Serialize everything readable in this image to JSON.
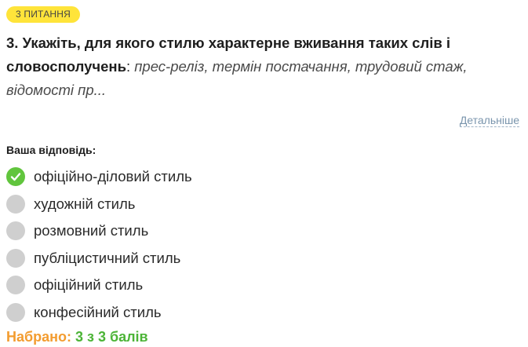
{
  "question_badge": "3 ПИТАННЯ",
  "question": {
    "bold_text": "3. Укажіть, для якого стилю характерне вживання таких слів і словосполучень",
    "separator": ":",
    "italic_text": "прес-реліз, термін постачання, трудовий стаж, відомості пр..."
  },
  "details_link": "Детальніше",
  "answer_label": "Ваша відповідь:",
  "options": [
    {
      "label": "офіційно-діловий стиль",
      "state": "correct-selected",
      "icon": "check-icon"
    },
    {
      "label": "художній стиль",
      "state": "unselected",
      "icon": "radio-icon"
    },
    {
      "label": "розмовний стиль",
      "state": "unselected",
      "icon": "radio-icon"
    },
    {
      "label": "публіцистичний стиль",
      "state": "unselected",
      "icon": "radio-icon"
    },
    {
      "label": "офіційний стиль",
      "state": "unselected",
      "icon": "radio-icon"
    },
    {
      "label": "конфесійний стиль",
      "state": "unselected",
      "icon": "radio-icon"
    }
  ],
  "score": {
    "label": "Набрано:",
    "value": "3 з 3 балів"
  },
  "colors": {
    "badge": "#ffe43a",
    "correct": "#61c53d",
    "unselected": "#cfcfcf",
    "score_label": "#f39c2f",
    "score_value": "#4cb437",
    "link": "#7a95ad"
  }
}
